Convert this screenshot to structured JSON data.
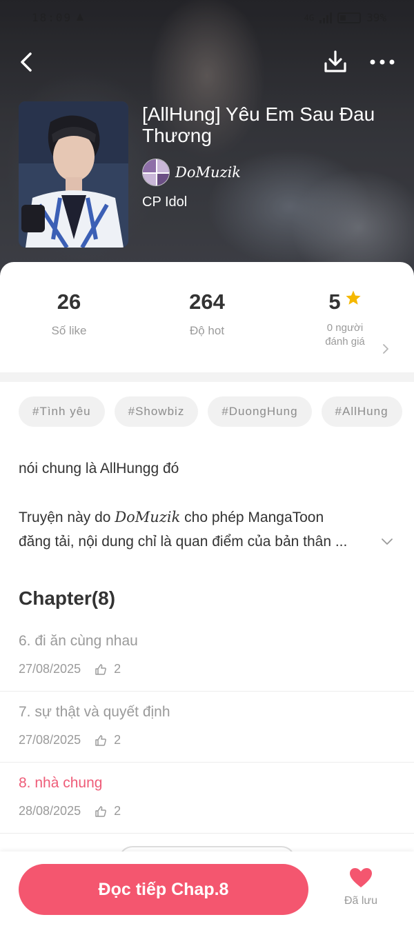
{
  "status_bar": {
    "time": "18:09",
    "battery": "39%",
    "network": "4G"
  },
  "story": {
    "title": "[AllHung] Yêu Em Sau Đau Thương",
    "author": "DoMuzik",
    "category": "CP Idol"
  },
  "stats": {
    "likes": {
      "value": "26",
      "label": "Số like"
    },
    "hot": {
      "value": "264",
      "label": "Độ hot"
    },
    "rating": {
      "value": "5",
      "label_line1": "0 người",
      "label_line2": "đánh giá"
    }
  },
  "tags": [
    "#Tình yêu",
    "#Showbiz",
    "#DuongHung",
    "#AllHung"
  ],
  "description": {
    "line1": "nói chung là AllHungg đó",
    "para2_prefix": "Truyện này do ",
    "para2_author": "DoMuzik",
    "para2_suffix": " cho phép MangaToon",
    "para2_line2": "đăng tải, nội dung chỉ là quan điểm của bản thân ..."
  },
  "chapters": {
    "heading": "Chapter(8)",
    "items": [
      {
        "title": "6. đi ăn cùng nhau",
        "date": "27/08/2025",
        "likes": "2"
      },
      {
        "title": "7. sự thật và quyết định",
        "date": "27/08/2025",
        "likes": "2"
      },
      {
        "title": "8. nhà chung",
        "date": "28/08/2025",
        "likes": "2"
      }
    ]
  },
  "bottom": {
    "read_button": "Đọc tiếp Chap.8",
    "saved_label": "Đã lưu"
  },
  "colors": {
    "accent": "#f4566f",
    "current_chapter": "#ee5c78",
    "star": "#f5b800",
    "muted_text": "#9a9a9a"
  },
  "icons": [
    "back-arrow-icon",
    "download-icon",
    "more-dots-icon",
    "star-icon",
    "chevron-right-icon",
    "chevron-down-icon",
    "thumbs-up-icon",
    "heart-icon"
  ]
}
